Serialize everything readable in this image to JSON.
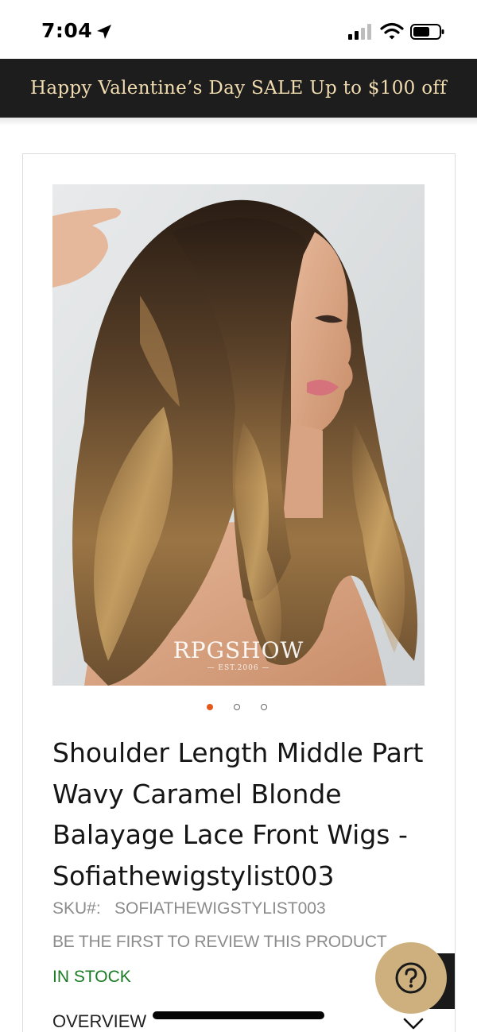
{
  "status_bar": {
    "time": "7:04",
    "icons": [
      "location-arrow-icon",
      "cellular-signal-icon",
      "wifi-icon",
      "battery-icon"
    ]
  },
  "promo": {
    "text": "Happy Valentine’s Day SALE Up to $100 off",
    "bg_color": "#1d1d1d",
    "text_color": "#f1dcb0"
  },
  "product": {
    "image": {
      "description_icon": "product-photo",
      "brand": "RPGSHOW",
      "est": "EST.2006"
    },
    "carousel": {
      "total": 3,
      "active": 1,
      "active_color": "#e4581a"
    },
    "title_lines": [
      "Shoulder Length Middle Part",
      "Wavy Caramel Blonde",
      "Balayage Lace Front Wigs -",
      "Sofiathewigstylist003"
    ],
    "sku_label": "SKU#:",
    "sku_value": "SOFIATHEWIGSTYLIST003",
    "review_link": "BE THE FIRST TO REVIEW THIS PRODUCT",
    "stock": "IN STOCK",
    "stock_color": "#1a7a24",
    "overview_label": "OVERVIEW"
  },
  "help_button": {
    "icon": "question-mark-icon",
    "color": "#cdb07e"
  }
}
